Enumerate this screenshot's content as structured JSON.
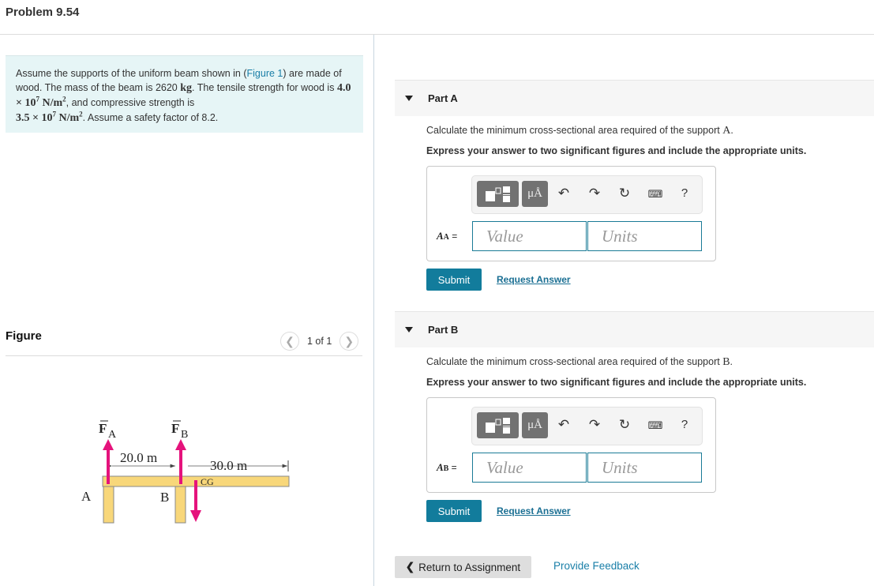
{
  "page": {
    "title": "Problem 9.54"
  },
  "problem": {
    "text_1": "Assume the supports of the uniform beam shown in (",
    "figure_link": "Figure 1",
    "text_2": ") are made of wood. The mass of the beam is 2620 ",
    "mass_unit": "kg",
    "text_3": ". The tensile strength for wood is ",
    "tensile_strength": "4.0 × 10",
    "tensile_exp": "7",
    "tensile_unit": " N/m",
    "tensile_unit_exp": "2",
    "text_4": ", and compressive strength is ",
    "compressive_strength": "3.5 × 10",
    "compressive_exp": "7",
    "compressive_unit": " N/m",
    "compressive_unit_exp": "2",
    "text_5": ". Assume a safety factor of 8.2."
  },
  "figure": {
    "heading": "Figure",
    "counter": "1 of 1",
    "prev_icon": "chevron-left-icon",
    "next_icon": "chevron-right-icon",
    "labels": {
      "fa": "F",
      "fa_sub": "A",
      "fb": "F",
      "fb_sub": "B",
      "dist_ab": "20.0 m",
      "dist_b_end": "30.0 m",
      "cg": "CG",
      "support_a": "A",
      "support_b": "B"
    },
    "colors": {
      "beam": "#f8d77a",
      "beam_edge": "#888888",
      "force": "#e5137c"
    }
  },
  "parts": [
    {
      "label": "Part A",
      "question": "Calculate the minimum cross-sectional area required of the support ",
      "question_var": "A",
      "instruction": "Express your answer to two significant figures and include the appropriate units.",
      "answer_var": "A",
      "answer_sub": "A",
      "equals": " =",
      "value_placeholder": "Value",
      "units_placeholder": "Units",
      "submit_label": "Submit",
      "request_label": "Request Answer"
    },
    {
      "label": "Part B",
      "question": "Calculate the minimum cross-sectional area required of the support ",
      "question_var": "B",
      "instruction": "Express your answer to two significant figures and include the appropriate units.",
      "answer_var": "A",
      "answer_sub": "B",
      "equals": " =",
      "value_placeholder": "Value",
      "units_placeholder": "Units",
      "submit_label": "Submit",
      "request_label": "Request Answer"
    }
  ],
  "toolbar": {
    "template_icon": "fraction-template-icon",
    "units_label": "μÅ",
    "undo_icon": "undo-icon",
    "redo_icon": "redo-icon",
    "reset_icon": "reset-icon",
    "keyboard_icon": "keyboard-icon",
    "help_label": "?"
  },
  "footer": {
    "return_label": "Return to Assignment",
    "feedback_label": "Provide Feedback"
  },
  "colors": {
    "accent": "#127c9c",
    "link": "#1a7fa8",
    "problem_bg": "#e6f5f6"
  }
}
